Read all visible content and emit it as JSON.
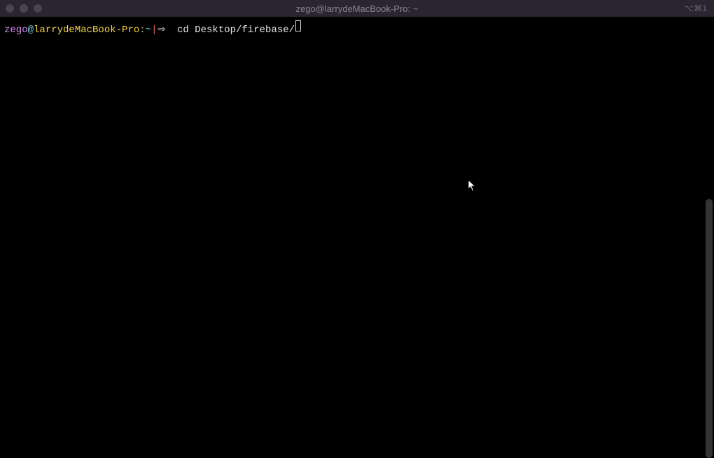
{
  "titlebar": {
    "title": "zego@larrydeMacBook-Pro: ~",
    "right_indicator": "⌥⌘1"
  },
  "prompt": {
    "user": "zego",
    "at": "@",
    "host": "larrydeMacBook-Pro",
    "colon": ":",
    "path": "~",
    "pipe": "|",
    "arrow": "⇒",
    "command": "cd Desktop/firebase/"
  }
}
